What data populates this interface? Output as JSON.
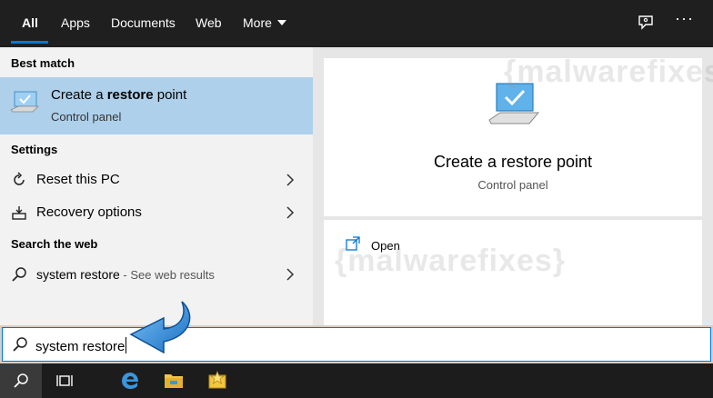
{
  "tabs": [
    {
      "label": "All"
    },
    {
      "label": "Apps"
    },
    {
      "label": "Documents"
    },
    {
      "label": "Web"
    },
    {
      "label": "More"
    }
  ],
  "sections": {
    "best_match": "Best match",
    "settings": "Settings",
    "search_web": "Search the web"
  },
  "best_match": {
    "title_prefix": "Create a ",
    "title_bold": "restore",
    "title_suffix": " point",
    "subtitle": "Control panel"
  },
  "settings_items": [
    {
      "label": "Reset this PC"
    },
    {
      "label": "Recovery options"
    }
  ],
  "web_result": {
    "query": "system restore",
    "suffix": " - See web results"
  },
  "preview": {
    "title": "Create a restore point",
    "subtitle": "Control panel",
    "open_label": "Open"
  },
  "search": {
    "value": "system restore"
  },
  "watermark": "{malwarefixes}",
  "colors": {
    "accent": "#0078d7",
    "selection": "#aed0ea"
  }
}
